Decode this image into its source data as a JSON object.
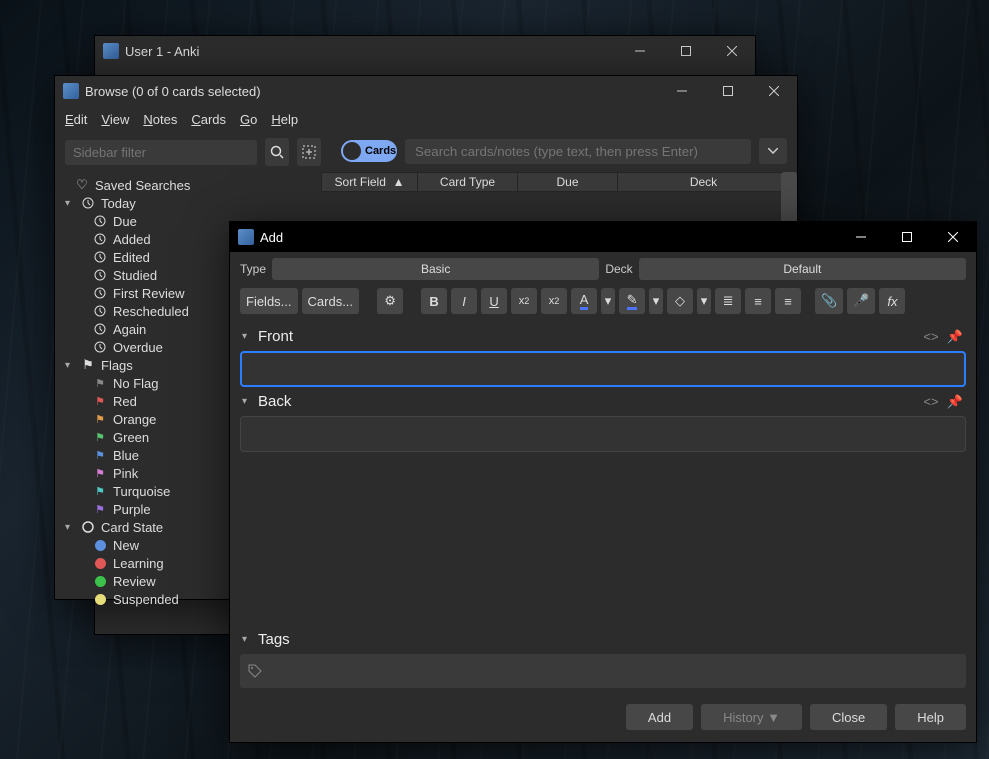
{
  "main": {
    "title": "User 1 - Anki"
  },
  "browse": {
    "title": "Browse (0 of 0 cards selected)",
    "menus": [
      "Edit",
      "View",
      "Notes",
      "Cards",
      "Go",
      "Help"
    ],
    "sidebar_placeholder": "Sidebar filter",
    "toggle_label": "Cards",
    "search_placeholder": "Search cards/notes (type text, then press Enter)",
    "columns": [
      "Sort Field",
      "Card Type",
      "Due",
      "Deck"
    ],
    "tree": {
      "saved_searches": "Saved Searches",
      "today": {
        "label": "Today",
        "children": [
          "Due",
          "Added",
          "Edited",
          "Studied",
          "First Review",
          "Rescheduled",
          "Again",
          "Overdue"
        ]
      },
      "flags": {
        "label": "Flags",
        "children": [
          {
            "label": "No Flag",
            "color": "#888"
          },
          {
            "label": "Red",
            "color": "#e05757"
          },
          {
            "label": "Orange",
            "color": "#e09a4a"
          },
          {
            "label": "Green",
            "color": "#58c470"
          },
          {
            "label": "Blue",
            "color": "#5b8fe0"
          },
          {
            "label": "Pink",
            "color": "#d67fd6"
          },
          {
            "label": "Turquoise",
            "color": "#4fc7c0"
          },
          {
            "label": "Purple",
            "color": "#9a6fe0"
          }
        ]
      },
      "card_state": {
        "label": "Card State",
        "children": [
          {
            "label": "New",
            "color": "#5b8fe0"
          },
          {
            "label": "Learning",
            "color": "#e05757"
          },
          {
            "label": "Review",
            "color": "#3cc24a"
          },
          {
            "label": "Suspended",
            "color": "#e6dd7a"
          }
        ]
      }
    }
  },
  "add": {
    "title": "Add",
    "type_label": "Type",
    "type_value": "Basic",
    "deck_label": "Deck",
    "deck_value": "Default",
    "fields_btn": "Fields...",
    "cards_btn": "Cards...",
    "front_label": "Front",
    "back_label": "Back",
    "tags_label": "Tags",
    "buttons": {
      "add": "Add",
      "history": "History ▼",
      "close": "Close",
      "help": "Help"
    }
  }
}
